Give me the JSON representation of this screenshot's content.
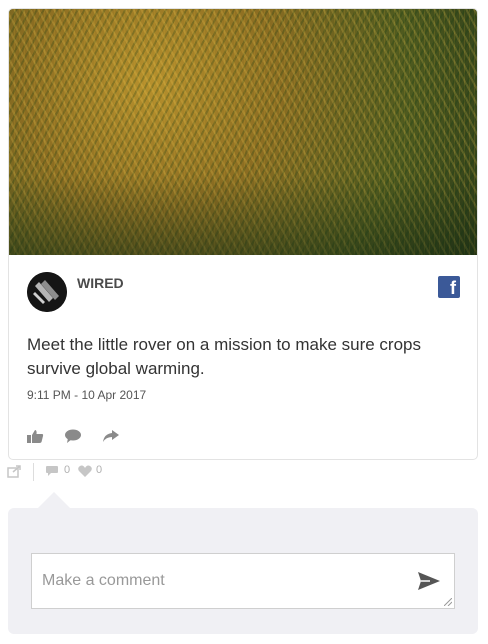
{
  "post": {
    "source": "WIRED",
    "text": "Meet the little rover on a mission to make sure crops survive global warming.",
    "timestamp": "9:11 PM - 10 Apr 2017",
    "network_icon": "facebook-icon",
    "actions": [
      "like-icon",
      "comment-icon",
      "share-icon"
    ]
  },
  "stats": {
    "comments": "0",
    "likes": "0"
  },
  "comment_box": {
    "placeholder": "Make a comment"
  },
  "colors": {
    "facebook": "#3b5998",
    "panel": "#f0f0f4"
  }
}
